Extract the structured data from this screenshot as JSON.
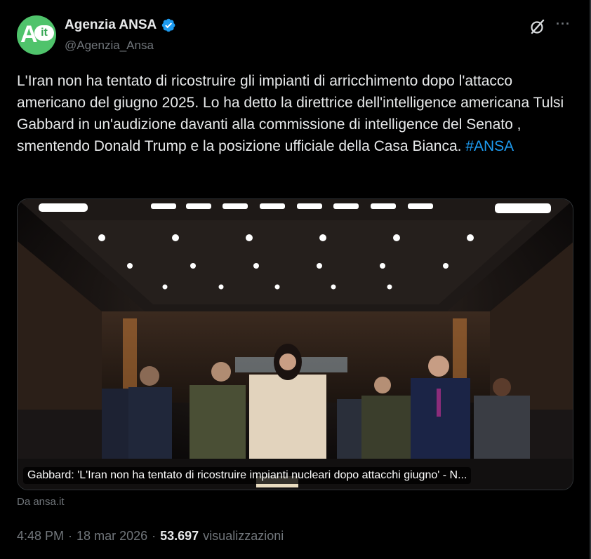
{
  "author": {
    "name": "Agenzia ANSA",
    "handle": "@Agenzia_Ansa",
    "avatar_letter": "A",
    "avatar_badge": "it",
    "avatar_color": "#4fc36b",
    "verified_color": "#1d9bf0"
  },
  "tweet": {
    "text": "L'Iran non ha tentato di ricostruire gli impianti di arricchimento dopo l'attacco americano del giugno 2025. Lo ha detto la direttrice dell'intelligence americana Tulsi Gabbard in un'audizione davanti alla commissione di intelligence del Senato , smentendo Donald Trump e la posizione ufficiale della Casa Bianca. ",
    "hashtag": "#ANSA",
    "hashtag_color": "#1d9bf0"
  },
  "card": {
    "caption": "Gabbard: 'L'Iran non ha tentato di ricostruire impianti nucleari dopo attacchi giugno' - N...",
    "source": "Da ansa.it"
  },
  "meta": {
    "time": "4:48 PM",
    "sep1": "·",
    "date": "18 mar 2026",
    "sep2": "·",
    "views_count": "53.697",
    "views_label": "visualizzazioni"
  },
  "icons": {
    "grok": "grok-icon",
    "more": "more-icon",
    "more_glyph": "···",
    "verified": "verified-badge-icon"
  }
}
